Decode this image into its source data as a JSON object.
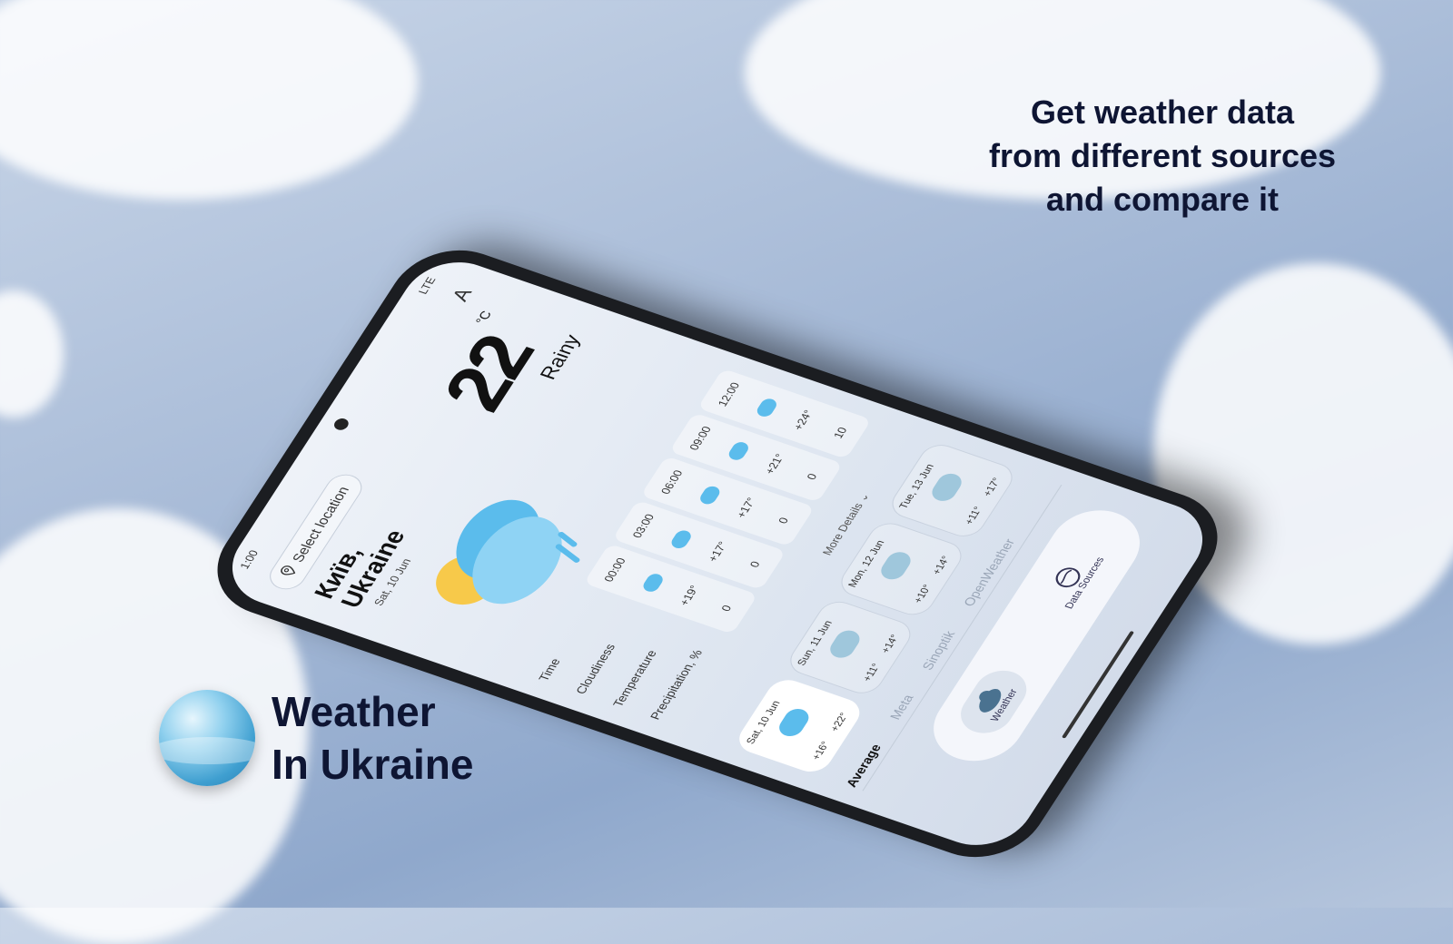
{
  "promo": {
    "headline_lines": [
      "Get weather data",
      "from different sources",
      "and compare it"
    ],
    "brand_line1": "Weather",
    "brand_line2": "In Ukraine"
  },
  "status": {
    "time": "1:00",
    "network": "LTE"
  },
  "header": {
    "select_location": "Select location",
    "translate_icon": "A"
  },
  "current": {
    "city_line1": "Київ,",
    "city_line2": "Ukraine",
    "date": "Sat, 10 Jun",
    "temperature": "22",
    "unit": "°C",
    "condition": "Rainy"
  },
  "hourly": {
    "row_labels": [
      "Time",
      "Cloudiness",
      "Temperature",
      "Precipitation, %"
    ],
    "columns": [
      {
        "time": "00:00",
        "temp": "+19°",
        "precip": "0"
      },
      {
        "time": "03:00",
        "temp": "+17°",
        "precip": "0"
      },
      {
        "time": "06:00",
        "temp": "+17°",
        "precip": "0"
      },
      {
        "time": "09:00",
        "temp": "+21°",
        "precip": "0"
      },
      {
        "time": "12:00",
        "temp": "+24°",
        "precip": "10"
      }
    ],
    "more_details": "More Details"
  },
  "daily": [
    {
      "label": "Sat, 10 Jun",
      "min": "+16°",
      "max": "+22°",
      "selected": true
    },
    {
      "label": "Sun, 11 Jun",
      "min": "+11°",
      "max": "+14°",
      "selected": false
    },
    {
      "label": "Mon, 12 Jun",
      "min": "+10°",
      "max": "+14°",
      "selected": false
    },
    {
      "label": "Tue, 13 Jun",
      "min": "+11°",
      "max": "+17°",
      "selected": false
    }
  ],
  "source_tabs": [
    "Average",
    "Meta",
    "Sinoptik",
    "OpenWeather"
  ],
  "bottom_nav": [
    {
      "label": "Weather",
      "active": true
    },
    {
      "label": "Data Sources",
      "active": false
    }
  ],
  "colors": {
    "headline": "#0e1533",
    "accent": "#5bbcec"
  }
}
